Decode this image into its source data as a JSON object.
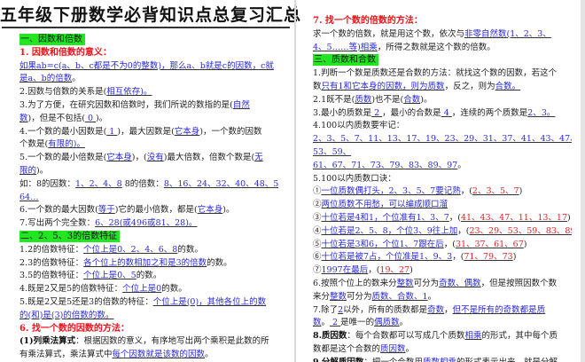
{
  "title": "五年级下册数学必背知识点总复习汇总",
  "left_lines": [
    [
      {
        "t": "一、因数和倍数",
        "s": "g"
      }
    ],
    [
      {
        "t": "1. 因数和倍数的意义：",
        "s": "h"
      }
    ],
    [
      {
        "t": "如果ab=c(a、b、c都是不为0的整数)，那么a、b就是c的因数，c就",
        "s": "u"
      }
    ],
    [
      {
        "t": "是a、b的倍数",
        "s": "u"
      },
      {
        "t": "。",
        "s": "n"
      }
    ],
    [
      {
        "t": "2.因数与倍数的关系是(",
        "s": "n"
      },
      {
        "t": "相互依存)。",
        "s": "u"
      }
    ],
    [
      {
        "t": "3.为了方便，在研究因数和倍数时，我们所说的数指的是(",
        "s": "n"
      },
      {
        "t": "自然",
        "s": "u"
      }
    ],
    [
      {
        "t": "数",
        "s": "u"
      },
      {
        "t": ")，但是不包括(",
        "s": "n"
      },
      {
        "t": " 0 ",
        "s": "u"
      },
      {
        "t": ")。",
        "s": "n"
      }
    ],
    [
      {
        "t": "4.一个数的最小因数是(",
        "s": "n"
      },
      {
        "t": " 1 ",
        "s": "u"
      },
      {
        "t": ")，最大因数是(",
        "s": "n"
      },
      {
        "t": "它本身",
        "s": "u"
      },
      {
        "t": ")，一个数的因数",
        "s": "n"
      }
    ],
    [
      {
        "t": "个数是(",
        "s": "n"
      },
      {
        "t": "有限的)。",
        "s": "u"
      }
    ],
    [
      {
        "t": "5.一个数的最小倍数是(",
        "s": "n"
      },
      {
        "t": "它本身",
        "s": "u"
      },
      {
        "t": ")，(",
        "s": "n"
      },
      {
        "t": "没有",
        "s": "u"
      },
      {
        "t": ")最大倍数，倍数个数是(",
        "s": "n"
      },
      {
        "t": "无",
        "s": "u"
      }
    ],
    [
      {
        "t": "限的",
        "s": "u"
      },
      {
        "t": ")。",
        "s": "n"
      }
    ],
    [
      {
        "t": "如：8的因数：",
        "s": "n"
      },
      {
        "t": "1、2、4、8",
        "s": "u"
      },
      {
        "t": "  8的倍数：",
        "s": "n"
      },
      {
        "t": "8、16、24、32、40、48、56、",
        "s": "u"
      }
    ],
    [
      {
        "t": "64…",
        "s": "u"
      }
    ],
    [
      {
        "t": "6.一个数的最大因数(",
        "s": "n"
      },
      {
        "t": "等于",
        "s": "u"
      },
      {
        "t": ")它的最小倍数，都是(",
        "s": "n"
      },
      {
        "t": "它本身",
        "s": "u"
      },
      {
        "t": ")。",
        "s": "n"
      }
    ],
    [
      {
        "t": "7.写出两个完全数：",
        "s": "n"
      },
      {
        "t": "6、28(或496或81、28)。",
        "s": "u"
      }
    ],
    [
      {
        "t": "二、2、5、3的倍数特征",
        "s": "g"
      }
    ],
    [
      {
        "t": "1.2的倍数特征：",
        "s": "n"
      },
      {
        "t": "个位上是0、2、4、6、8",
        "s": "u"
      },
      {
        "t": "的数。",
        "s": "n"
      }
    ],
    [
      {
        "t": "2.3的倍数特征：",
        "s": "n"
      },
      {
        "t": "各个位上的数相加之和是3的倍数",
        "s": "u"
      },
      {
        "t": "的数。",
        "s": "n"
      }
    ],
    [
      {
        "t": "3.5的倍数特征：",
        "s": "n"
      },
      {
        "t": "个位上是0、5",
        "s": "u"
      },
      {
        "t": "的数。",
        "s": "n"
      }
    ],
    [
      {
        "t": "4.既是2又是5的倍数特征：",
        "s": "n"
      },
      {
        "t": "个位上是0",
        "s": "u"
      },
      {
        "t": "的数。",
        "s": "n"
      }
    ],
    [
      {
        "t": "5.既是2又是5还是3的倍数的特征：",
        "s": "n"
      },
      {
        "t": "个位上是(0)，其他各位上的数",
        "s": "u"
      }
    ],
    [
      {
        "t": "的(和)是(3)的倍数的数。",
        "s": "u"
      }
    ],
    [
      {
        "t": "6. 找一个数的因数的方法：",
        "s": "h"
      }
    ],
    [
      {
        "t": "(1)列乘法算式",
        "s": "b"
      },
      {
        "t": "：根据因数的意义，有序地写出两个乘积是此数的所",
        "s": "n"
      }
    ],
    [
      {
        "t": "有乘法算式，乘法算式中",
        "s": "n"
      },
      {
        "t": "每个因数就是该数的因数",
        "s": "u"
      },
      {
        "t": "。",
        "s": "n"
      }
    ]
  ],
  "right_lines": [
    [
      {
        "t": "7. 找一个数的倍数的方法：",
        "s": "h"
      }
    ],
    [
      {
        "t": "求一个数的倍数，就是用这个数，依次与",
        "s": "n"
      },
      {
        "t": "非零自然数(1、2、3、",
        "s": "u"
      }
    ],
    [
      {
        "t": "4、5……等)相乘",
        "s": "u"
      },
      {
        "t": "，所得之数就是这个数的倍数。",
        "s": "n"
      }
    ],
    [
      {
        "t": "三、质数和合数",
        "s": "g"
      }
    ],
    [
      {
        "t": "1.判断一个数是质数还是合数的方法：就找这个数的因数，若这个",
        "s": "n"
      }
    ],
    [
      {
        "t": "数",
        "s": "n"
      },
      {
        "t": "只有1和它本身的因数，则为质数",
        "s": "u"
      },
      {
        "t": "，反之，则为",
        "s": "n"
      },
      {
        "t": "合数。",
        "s": "u"
      }
    ],
    [
      {
        "t": "2.1既不是(",
        "s": "n"
      },
      {
        "t": "质数",
        "s": "u"
      },
      {
        "t": ")也不是(",
        "s": "n"
      },
      {
        "t": "合数",
        "s": "u"
      },
      {
        "t": ")。",
        "s": "n"
      }
    ],
    [
      {
        "t": "3.最小的质数是",
        "s": "n"
      },
      {
        "t": " 2 ",
        "s": "u"
      },
      {
        "t": "，最小的合数是",
        "s": "n"
      },
      {
        "t": " 4 ",
        "s": "u"
      },
      {
        "t": "，连续的两个质数是",
        "s": "n"
      },
      {
        "t": "2、3。",
        "s": "u"
      }
    ],
    [
      {
        "t": "4.100以内质数要牢记：",
        "s": "n"
      }
    ],
    [
      {
        "t": "2、3、5、7、11、13、17、19、23、29、31、37、41、43、47、",
        "s": "u"
      }
    ],
    [
      {
        "t": "53、59、",
        "s": "u"
      }
    ],
    [
      {
        "t": "61、67、71、73、79、83、89、97",
        "s": "u"
      },
      {
        "t": "。",
        "s": "n"
      }
    ],
    [
      {
        "t": "5.100以内质数口诀：",
        "s": "n"
      }
    ],
    [
      {
        "t": "①",
        "s": "n"
      },
      {
        "t": "一位质数偶打头，2、3、5、7要记熟",
        "s": "u"
      },
      {
        "t": "，(",
        "s": "n"
      },
      {
        "t": "2、3、5、7",
        "s": "r"
      },
      {
        "t": ")",
        "s": "n"
      }
    ],
    [
      {
        "t": "②",
        "s": "n"
      },
      {
        "t": "两位质数不用愁，可以编成顺口溜",
        "s": "u"
      }
    ],
    [
      {
        "t": "③",
        "s": "n"
      },
      {
        "t": "十位若是4和1，个位准有1、3、7",
        "s": "u"
      },
      {
        "t": "，(",
        "s": "n"
      },
      {
        "t": "41、43、47、11、13、17",
        "s": "r"
      },
      {
        "t": ")",
        "s": "n"
      }
    ],
    [
      {
        "t": "④",
        "s": "n"
      },
      {
        "t": "十位若是2、5、8，个位3、9往上加",
        "s": "u"
      },
      {
        "t": "，(",
        "s": "n"
      },
      {
        "t": "23、29、53、59、83、89",
        "s": "r"
      },
      {
        "t": ")",
        "s": "n"
      }
    ],
    [
      {
        "t": "⑤",
        "s": "n"
      },
      {
        "t": "十位若是3和6，个位1、7跟在后",
        "s": "u"
      },
      {
        "t": "，(",
        "s": "n"
      },
      {
        "t": "31、37、61、67",
        "s": "r"
      },
      {
        "t": ")",
        "s": "n"
      }
    ],
    [
      {
        "t": "⑥",
        "s": "n"
      },
      {
        "t": "十位若是被7占，个位准是1、9、3",
        "s": "u"
      },
      {
        "t": "，(",
        "s": "n"
      },
      {
        "t": "71、79、73",
        "s": "r"
      },
      {
        "t": ")",
        "s": "n"
      }
    ],
    [
      {
        "t": "⑦",
        "s": "n"
      },
      {
        "t": "1997在最后",
        "s": "u"
      },
      {
        "t": "，(",
        "s": "n"
      },
      {
        "t": "19、27",
        "s": "r"
      },
      {
        "t": ")",
        "s": "n"
      }
    ],
    [
      {
        "t": "6.按照个位上的数来分",
        "s": "n"
      },
      {
        "t": "整数",
        "s": "u"
      },
      {
        "t": "可分为",
        "s": "n"
      },
      {
        "t": "奇数、偶数",
        "s": "u"
      },
      {
        "t": "，但是按照因数个数",
        "s": "n"
      }
    ],
    [
      {
        "t": "来分",
        "s": "n"
      },
      {
        "t": "整数",
        "s": "u"
      },
      {
        "t": "可分为",
        "s": "n"
      },
      {
        "t": "质数、合数、1",
        "s": "u"
      },
      {
        "t": "。",
        "s": "n"
      }
    ],
    [
      {
        "t": "7.除了",
        "s": "n"
      },
      {
        "t": "2",
        "s": "u"
      },
      {
        "t": "以外，所有的质数都是",
        "s": "n"
      },
      {
        "t": "奇数",
        "s": "u"
      },
      {
        "t": "，",
        "s": "n"
      },
      {
        "t": "但不是所有的奇数都是质",
        "s": "u"
      }
    ],
    [
      {
        "t": "数",
        "s": "u"
      },
      {
        "t": "。",
        "s": "n"
      },
      {
        "t": " 2 ",
        "s": "u"
      },
      {
        "t": "是唯一的",
        "s": "n"
      },
      {
        "t": "偶质数",
        "s": "u"
      },
      {
        "t": "。",
        "s": "n"
      }
    ],
    [
      {
        "t": "8.质因数",
        "s": "b"
      },
      {
        "t": "：每个合数都可以写成几个质数",
        "s": "n"
      },
      {
        "t": "相乘",
        "s": "u"
      },
      {
        "t": "的形式，其中每个质",
        "s": "n"
      }
    ],
    [
      {
        "t": "数都是这个合数的",
        "s": "n"
      },
      {
        "t": "质因数",
        "s": "u"
      },
      {
        "t": "。",
        "s": "n"
      }
    ],
    [
      {
        "t": "9.分解质因数",
        "s": "b"
      },
      {
        "t": "：把一个合数用",
        "s": "n"
      },
      {
        "t": "质数相乘",
        "s": "u"
      },
      {
        "t": "的形式表示出来，就是分解",
        "s": "n"
      }
    ]
  ]
}
